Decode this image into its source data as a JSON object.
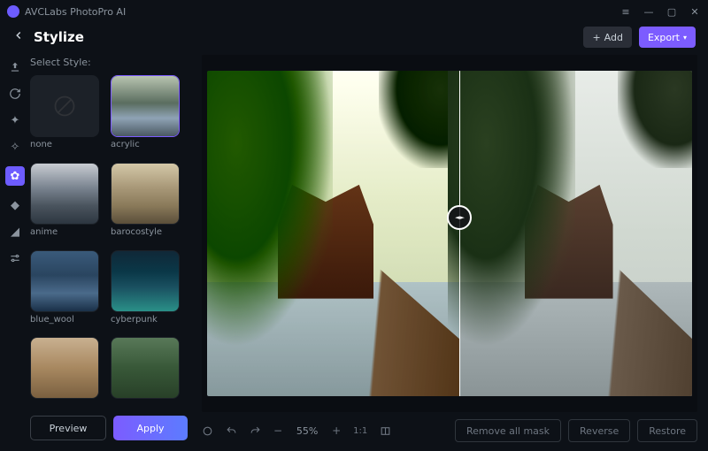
{
  "app": {
    "title": "AVCLabs PhotoPro AI"
  },
  "page": {
    "title": "Stylize"
  },
  "topbar": {
    "add_label": "Add",
    "export_label": "Export"
  },
  "sidebar": {
    "section_label": "Select Style:",
    "styles": [
      {
        "id": "none",
        "label": "none"
      },
      {
        "id": "acrylic",
        "label": "acrylic"
      },
      {
        "id": "anime",
        "label": "anime"
      },
      {
        "id": "barocostyle",
        "label": "barocostyle"
      },
      {
        "id": "blue_wool",
        "label": "blue_wool"
      },
      {
        "id": "cyberpunk",
        "label": "cyberpunk"
      }
    ],
    "selected_style": "acrylic",
    "preview_label": "Preview",
    "apply_label": "Apply"
  },
  "canvas": {
    "zoom": "55%",
    "ratio_label": "1:1"
  },
  "bottombar": {
    "remove_mask_label": "Remove all mask",
    "reverse_label": "Reverse",
    "restore_label": "Restore"
  },
  "rail_icons": [
    "upload",
    "refresh",
    "sparkle",
    "puzzle",
    "stylize",
    "paint",
    "cut",
    "sliders"
  ],
  "colors": {
    "accent": "#7c5cff",
    "bg": "#0d1117"
  }
}
